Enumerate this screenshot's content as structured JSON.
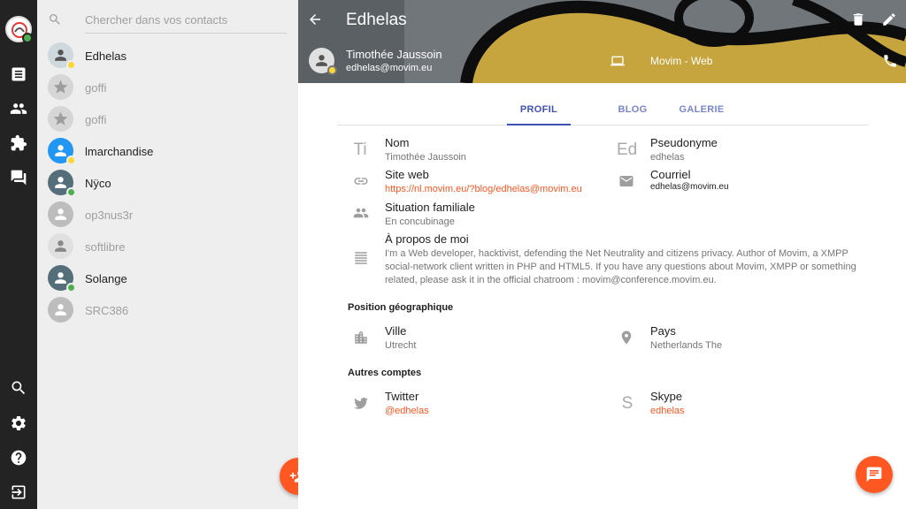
{
  "search": {
    "placeholder": "Chercher dans vos contacts"
  },
  "contacts": [
    {
      "name": "Edhelas",
      "presence": "away",
      "online": true
    },
    {
      "name": "goffi",
      "presence": "none",
      "online": false
    },
    {
      "name": "goffi",
      "presence": "none",
      "online": false
    },
    {
      "name": "lmarchandise",
      "presence": "away",
      "online": true
    },
    {
      "name": "Nÿco",
      "presence": "online",
      "online": true
    },
    {
      "name": "op3nus3r",
      "presence": "none",
      "online": false
    },
    {
      "name": "softlibre",
      "presence": "none",
      "online": false
    },
    {
      "name": "Solange",
      "presence": "online",
      "online": true
    },
    {
      "name": "SRC386",
      "presence": "none",
      "online": false
    }
  ],
  "header": {
    "title": "Edhelas",
    "user_name": "Timothée Jaussoin",
    "user_jid": "edhelas@movim.eu",
    "device": "Movim - Web"
  },
  "tabs": [
    {
      "label": "PROFIL",
      "active": true
    },
    {
      "label": "BLOG",
      "active": false
    },
    {
      "label": "GALERIE",
      "active": false
    }
  ],
  "profile": {
    "name_icon": "Ti",
    "name_label": "Nom",
    "name_value": "Timothée Jaussoin",
    "nick_icon": "Ed",
    "nick_label": "Pseudonyme",
    "nick_value": "edhelas",
    "website_label": "Site web",
    "website_value": "https://nl.movim.eu/?blog/edhelas@movim.eu",
    "email_label": "Courriel",
    "email_value": "edhelas@movim.eu",
    "marital_label": "Situation familiale",
    "marital_value": "En concubinage",
    "about_label": "À propos de moi",
    "about_value": "I'm a Web developer, hacktivist, defending the Net Neutrality and citizens privacy. Author of Movim, a XMPP social-network client written in PHP and HTML5. If you have any questions about Movim, XMPP or something related, please ask it in the official chatroom : movim@conference.movim.eu."
  },
  "location": {
    "section": "Position géographique",
    "city_label": "Ville",
    "city_value": "Utrecht",
    "country_label": "Pays",
    "country_value": "Netherlands The"
  },
  "accounts": {
    "section": "Autres comptes",
    "twitter_label": "Twitter",
    "twitter_value": "@edhelas",
    "skype_icon": "S",
    "skype_label": "Skype",
    "skype_value": "edhelas"
  },
  "colors": {
    "accent": "#ff5722",
    "tab": "#3f51b5",
    "online": "#4caf50",
    "away": "#fdd835",
    "rail": "#232323"
  }
}
